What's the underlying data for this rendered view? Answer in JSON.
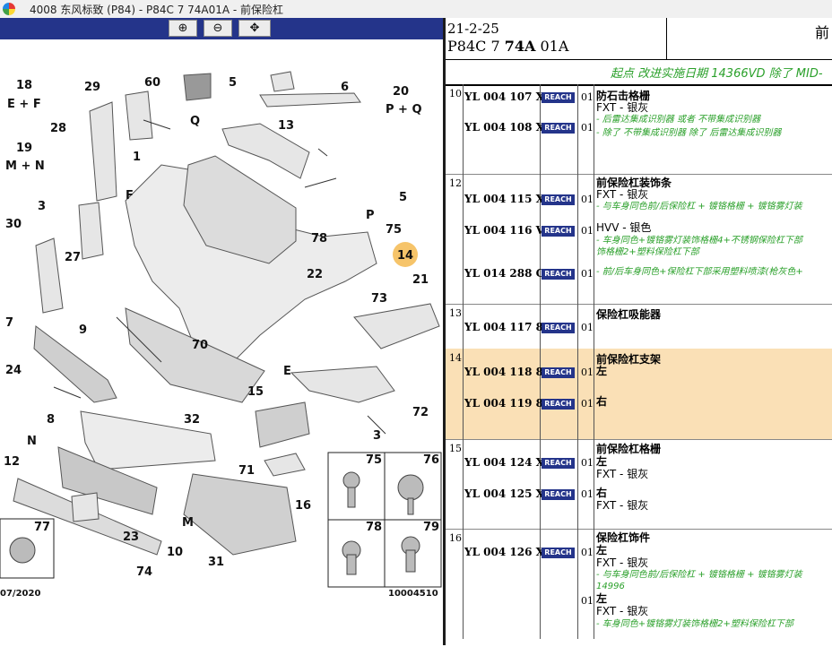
{
  "window": {
    "title": "4008 东风标致 (P84) - P84C 7 74A01A - 前保险杠"
  },
  "toolbar": {
    "zoom_in": "⊕",
    "zoom_out": "⊖",
    "pan": "✥"
  },
  "diagram": {
    "callouts": [
      "60",
      "5",
      "6",
      "29",
      "18",
      "E + F",
      "20",
      "P + Q",
      "Q",
      "28",
      "13",
      "19",
      "M + N",
      "1",
      "5",
      "3",
      "F",
      "78",
      "P",
      "75",
      "30",
      "27",
      "14",
      "22",
      "21",
      "73",
      "7",
      "9",
      "70",
      "24",
      "E",
      "8",
      "32",
      "15",
      "72",
      "3",
      "N",
      "71",
      "12",
      "M",
      "16",
      "77",
      "23",
      "10",
      "74",
      "31",
      "75",
      "76",
      "78",
      "79"
    ],
    "footer_left": "07/2020",
    "footer_right": "10004510"
  },
  "header": {
    "date": "21-2-25",
    "code_pre": "P84C 7 ",
    "code_bold": "74A",
    "code_post": " 01A",
    "title": "前",
    "note": "起点 改进实施日期 14366VD 除了 MID-"
  },
  "reach_label": "REACH",
  "groups": [
    {
      "num": "10",
      "rows": [
        {
          "pn": "YL 004 107 XT",
          "qty": "01",
          "lines": [
            {
              "t": "防石击格栅",
              "s": "b"
            },
            {
              "t": "FXT - 银灰",
              "s": ""
            },
            {
              "t": "- 后雷达集成识别器 或者 不带集成识别器",
              "s": "g"
            }
          ]
        },
        {
          "pn": "YL 004 108 XT",
          "qty": "01",
          "lines": [
            {
              "t": "- 除了 不带集成识别器 除了 后雷达集成识别器",
              "s": "g"
            }
          ]
        }
      ]
    },
    {
      "num": "12",
      "rows": [
        {
          "pn": "YL 004 115 XT",
          "qty": "01",
          "lines": [
            {
              "t": "前保险杠装饰条",
              "s": "b"
            },
            {
              "t": "FXT - 银灰",
              "s": ""
            },
            {
              "t": "- 与车身同色前/后保险杠 + 镀铬格栅 + 镀铬雾灯装",
              "s": "g"
            }
          ]
        },
        {
          "pn": "YL 004 116 VV",
          "qty": "01",
          "lines": [
            {
              "t": "HVV - 银色",
              "s": ""
            },
            {
              "t": "- 车身同色+镀铬雾灯装饰格栅4+不锈钢保险杠下部",
              "s": "g"
            },
            {
              "t": "饰格栅2+塑料保险杠下部",
              "s": "g"
            }
          ]
        },
        {
          "pn": "YL 014 288 CX",
          "qty": "01",
          "lines": [
            {
              "t": "- 前/后车身同色+保险杠下部采用塑料喷漆(枪灰色+",
              "s": "g"
            }
          ]
        }
      ]
    },
    {
      "num": "13",
      "rows": [
        {
          "pn": "YL 004 117 80",
          "qty": "01",
          "lines": [
            {
              "t": "保险杠吸能器",
              "s": "b"
            }
          ]
        }
      ]
    },
    {
      "num": "14",
      "rows": [
        {
          "pn": "YL 004 118 80",
          "qty": "01",
          "lines": [
            {
              "t": "前保险杠支架",
              "s": "b"
            },
            {
              "t": "左",
              "s": "b"
            }
          ]
        },
        {
          "pn": "YL 004 119 80",
          "qty": "01",
          "lines": [
            {
              "t": "右",
              "s": "b"
            }
          ]
        }
      ]
    },
    {
      "num": "15",
      "rows": [
        {
          "pn": "YL 004 124 XT",
          "qty": "01",
          "lines": [
            {
              "t": "前保险杠格栅",
              "s": "b"
            },
            {
              "t": "左",
              "s": "b"
            },
            {
              "t": "FXT - 银灰",
              "s": ""
            }
          ]
        },
        {
          "pn": "YL 004 125 XT",
          "qty": "01",
          "lines": [
            {
              "t": "右",
              "s": "b"
            },
            {
              "t": "FXT - 银灰",
              "s": ""
            }
          ]
        }
      ]
    },
    {
      "num": "16",
      "rows": [
        {
          "pn": "YL 004 126 XT",
          "qty": "01",
          "lines": [
            {
              "t": "保险杠饰件",
              "s": "b"
            },
            {
              "t": "左",
              "s": "b"
            },
            {
              "t": "FXT - 银灰",
              "s": ""
            },
            {
              "t": "- 与车身同色前/后保险杠 + 镀铬格栅 + 镀铬雾灯装",
              "s": "g"
            },
            {
              "t": "14996",
              "s": "g"
            }
          ]
        },
        {
          "pn": "",
          "qty": "01",
          "lines": [
            {
              "t": "左",
              "s": "b"
            },
            {
              "t": "FXT - 银灰",
              "s": ""
            },
            {
              "t": "- 车身同色+镀铬雾灯装饰格栅2+塑料保险杠下部",
              "s": "g"
            }
          ]
        }
      ]
    }
  ]
}
